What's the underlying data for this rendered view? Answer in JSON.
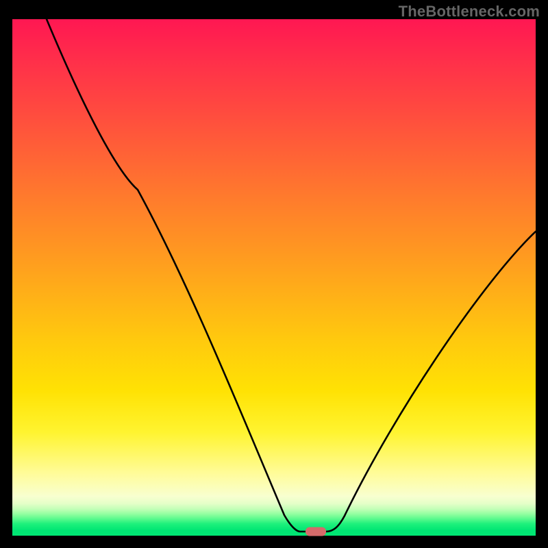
{
  "watermark": "TheBottleneck.com",
  "chart_data": {
    "type": "line",
    "title": "",
    "xlabel": "",
    "ylabel": "",
    "xlim": [
      0,
      100
    ],
    "ylim": [
      0,
      100
    ],
    "series": [
      {
        "name": "curve",
        "points": [
          {
            "x": 6.5,
            "y": 100
          },
          {
            "x": 24,
            "y": 67
          },
          {
            "x": 52,
            "y": 4
          },
          {
            "x": 55,
            "y": 0.8
          },
          {
            "x": 60,
            "y": 0.8
          },
          {
            "x": 63,
            "y": 3
          },
          {
            "x": 100,
            "y": 59
          }
        ]
      }
    ],
    "optimal_marker": {
      "x": 58,
      "y": 0.8
    },
    "gradient_stops": [
      {
        "pos": 0,
        "color": "#ff1752"
      },
      {
        "pos": 50,
        "color": "#ffbd12"
      },
      {
        "pos": 85,
        "color": "#fffc9a"
      },
      {
        "pos": 100,
        "color": "#00e673"
      }
    ]
  }
}
